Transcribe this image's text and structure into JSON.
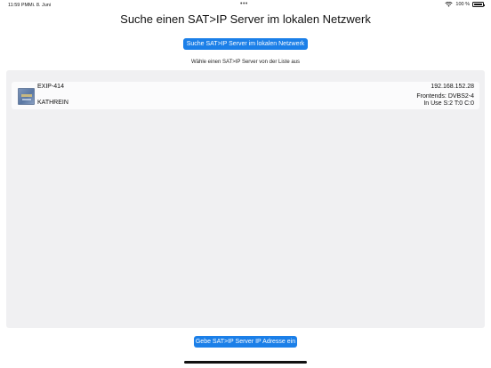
{
  "status_bar": {
    "time": "11:59 PM",
    "date": "Mi. 8. Juni",
    "dots": "•••",
    "battery": "100 %",
    "icons": [
      "wifi-icon",
      "battery-icon"
    ]
  },
  "title": "Suche einen SAT>IP Server im lokalen Netzwerk",
  "search_button": {
    "label": "Suche SAT>IP Server im lokalen Netzwerk"
  },
  "list_caption": "Wähle einen SAT>IP Server von der Liste aus",
  "servers": [
    {
      "name": "EXIP-414",
      "vendor": "KATHREIN",
      "ip": "192.168.152.28",
      "frontends": "Frontends: DVBS2-4",
      "in_use": "In Use S:2 T:0 C:0"
    }
  ],
  "manual_button": {
    "label": "Gebe SAT>IP Server IP Adresse ein"
  },
  "colors": {
    "accent": "#1b7fe8",
    "panel": "#f0f0f2"
  }
}
